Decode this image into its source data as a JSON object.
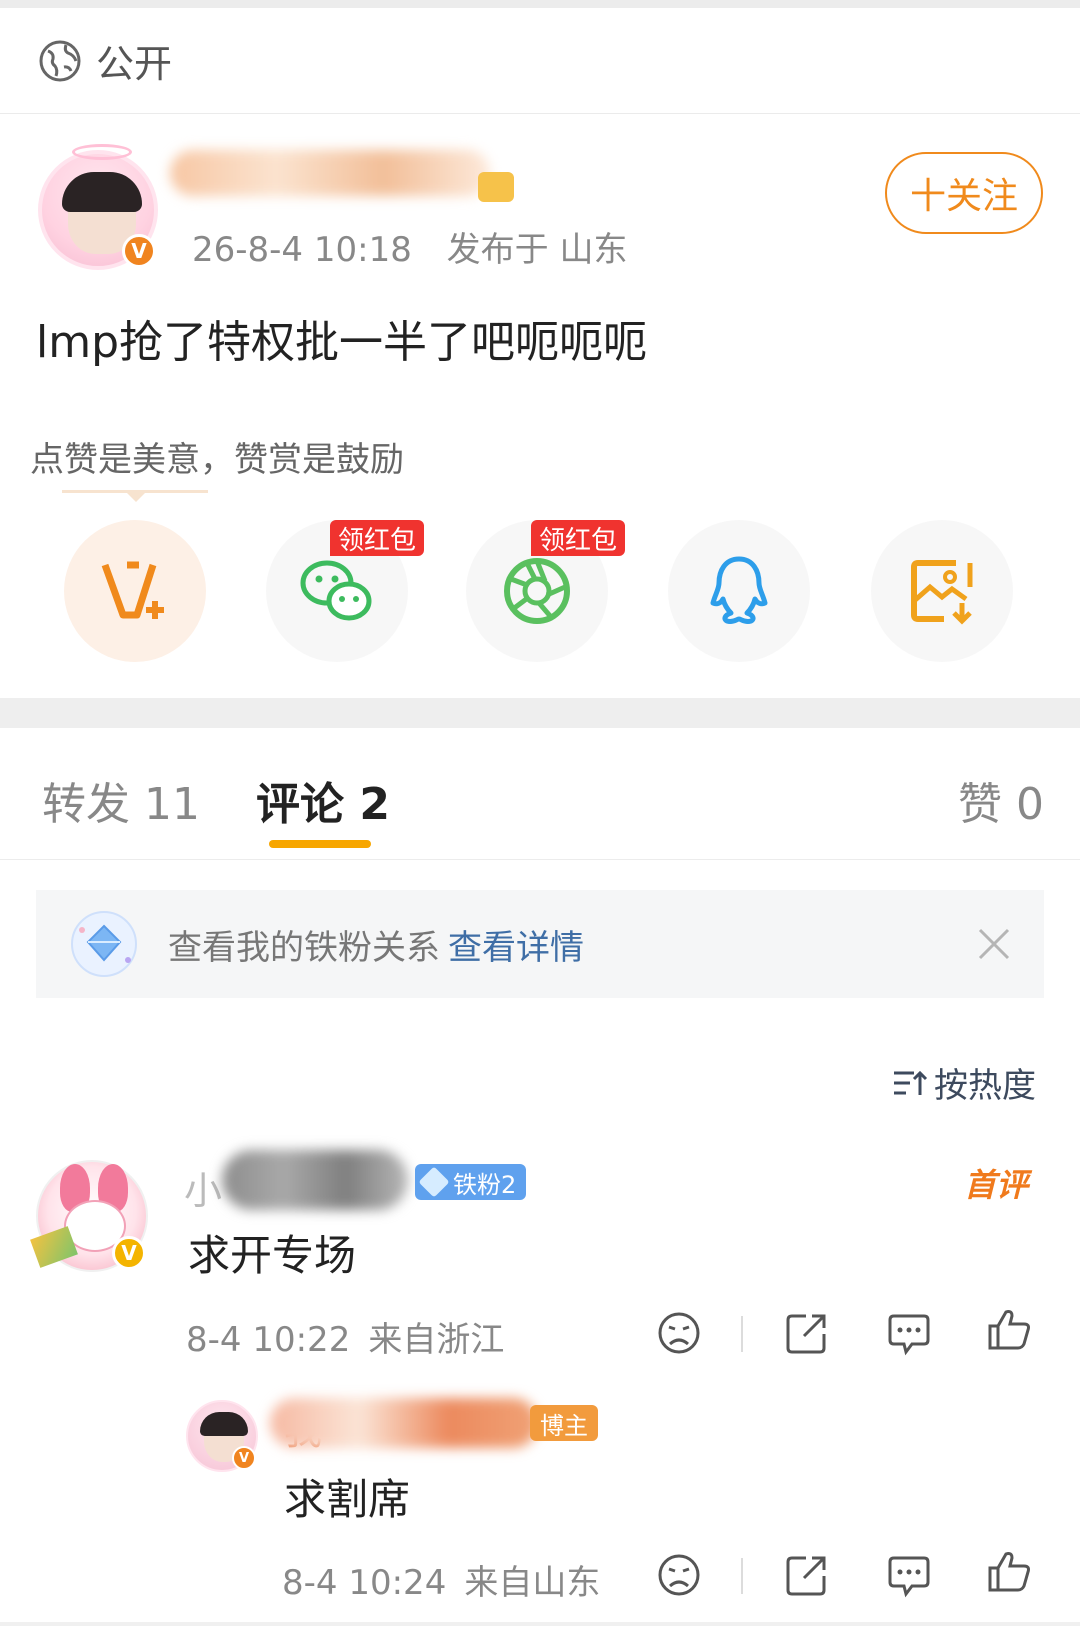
{
  "privacy": {
    "label": "公开",
    "icon": "globe-icon"
  },
  "post": {
    "timestamp": "26-8-4 10:18",
    "location": "发布于 山东",
    "follow_label": "十关注",
    "text": "lmp抢了特权批一半了吧呃呃呃",
    "reward_hint": "点赞是美意，赞赏是鼓励"
  },
  "share": {
    "red_packet_label": "领红包",
    "items": [
      "reward-v-icon",
      "wechat-icon",
      "moments-icon",
      "qq-icon",
      "save-image-icon"
    ]
  },
  "tabs": [
    {
      "label": "转发 11"
    },
    {
      "label": "评论 2"
    },
    {
      "label": "赞 0"
    }
  ],
  "fans_banner": {
    "text": "查看我的铁粉关系",
    "link": "查看详情"
  },
  "sort": {
    "label": "按热度"
  },
  "comments": [
    {
      "name_prefix": "小",
      "badge": "铁粉2",
      "tag": "首评",
      "text": "求开专场",
      "time": "8-4 10:22",
      "location": "来自浙江"
    },
    {
      "name_prefix": "我",
      "badge": "博主",
      "text": "求割席",
      "time": "8-4 10:24",
      "location": "来自山东"
    }
  ],
  "colors": {
    "accent": "#f08a1c",
    "tab_indicator": "#f7a600",
    "link": "#3f6ea6",
    "red_tag": "#f0332f"
  }
}
